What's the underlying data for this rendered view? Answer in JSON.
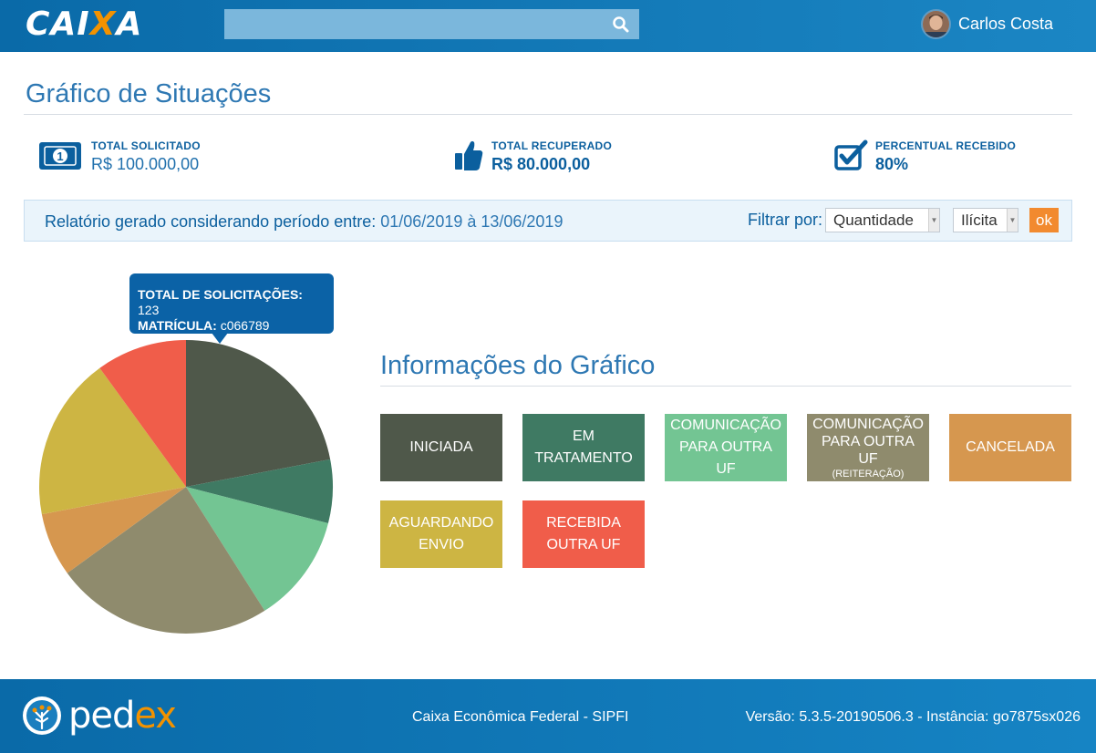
{
  "header": {
    "logo_text_a": "CAI",
    "logo_text_x": "X",
    "logo_text_b": "A",
    "search_placeholder": "",
    "user_name": "Carlos Costa"
  },
  "page_title": "Gráfico de Situações",
  "stats": [
    {
      "label": "TOTAL SOLICITADO",
      "value": "R$ 100.000,00",
      "icon": "money-bill-icon"
    },
    {
      "label": "TOTAL RECUPERADO",
      "value": "R$ 80.000,00",
      "icon": "thumbs-up-icon"
    },
    {
      "label": "PERCENTUAL RECEBIDO",
      "value": "80%",
      "icon": "checkbox-check-icon"
    }
  ],
  "filter": {
    "period_label": "Relatório gerado considerando período entre:",
    "period_value": "01/06/2019 à 13/06/2019",
    "filter_label": "Filtrar por:",
    "select_type": "Quantidade",
    "select_category": "Ilícita",
    "ok_label": "ok"
  },
  "tooltip": {
    "total_label": "TOTAL DE SOLICITAÇÕES:",
    "total_value": "123",
    "matricula_label": "MATRÍCULA:",
    "matricula_value": "c066789"
  },
  "info_title": "Informações do Gráfico",
  "legend": [
    {
      "line1": "INICIADA",
      "line2": "",
      "small": "",
      "color": "#4f584a"
    },
    {
      "line1": "EM",
      "line2": "TRATAMENTO",
      "small": "",
      "color": "#3f7a63"
    },
    {
      "line1": "COMUNICAÇÃO",
      "line2": "PARA OUTRA UF",
      "small": "",
      "color": "#73c593"
    },
    {
      "line1": "COMUNICAÇÃO",
      "line2": "PARA OUTRA UF",
      "small": "(REITERAÇÃO)",
      "color": "#8f8b6d"
    },
    {
      "line1": "CANCELADA",
      "line2": "",
      "small": "",
      "color": "#d6974f"
    },
    {
      "line1": "AGUARDANDO",
      "line2": "ENVIO",
      "small": "",
      "color": "#cdb543"
    },
    {
      "line1": "RECEBIDA",
      "line2": "OUTRA UF",
      "small": "",
      "color": "#f05d4a"
    }
  ],
  "chart_data": {
    "type": "pie",
    "slices": [
      {
        "label": "INICIADA",
        "value": 22,
        "color": "#4f584a"
      },
      {
        "label": "EM TRATAMENTO",
        "value": 7,
        "color": "#3f7a63"
      },
      {
        "label": "COMUNICAÇÃO PARA OUTRA UF",
        "value": 12,
        "color": "#73c593"
      },
      {
        "label": "COMUNICAÇÃO PARA OUTRA UF (REITERAÇÃO)",
        "value": 24,
        "color": "#8f8b6d"
      },
      {
        "label": "CANCELADA",
        "value": 7,
        "color": "#d6974f"
      },
      {
        "label": "AGUARDANDO ENVIO",
        "value": 18,
        "color": "#cdb543"
      },
      {
        "label": "RECEBIDA OUTRA UF",
        "value": 10,
        "color": "#f05d4a"
      }
    ]
  },
  "footer": {
    "brand_a": "ped",
    "brand_b": "e",
    "brand_c": "x",
    "center_text": "Caixa Econômica Federal - SIPFI",
    "right_text": "Versão: 5.3.5-20190506.3 - Instância: go7875sx026"
  }
}
